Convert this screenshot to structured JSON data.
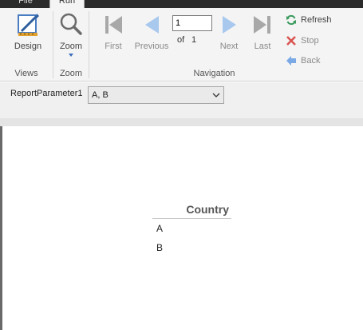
{
  "tabs": [
    {
      "label": "File"
    },
    {
      "label": "Run"
    }
  ],
  "ribbon": {
    "views": {
      "group_label": "Views",
      "design_label": "Design"
    },
    "zoom": {
      "group_label": "Zoom",
      "zoom_label": "Zoom"
    },
    "navigation": {
      "group_label": "Navigation",
      "first_label": "First",
      "previous_label": "Previous",
      "page_value": "1",
      "of_label": "of",
      "page_count": "1",
      "next_label": "Next",
      "last_label": "Last",
      "refresh_label": "Refresh",
      "stop_label": "Stop",
      "back_label": "Back"
    }
  },
  "parameters": {
    "label": "ReportParameter1",
    "selected_value": "A, B"
  },
  "report": {
    "column_header": "Country",
    "rows": [
      "A",
      "B"
    ]
  },
  "colors": {
    "nav_blue": "#a8c8ee",
    "nav_gray": "#9a9a9a",
    "refresh_green": "#3c9a5f",
    "stop_red": "#d9534f",
    "back_blue": "#7aa9e6"
  }
}
